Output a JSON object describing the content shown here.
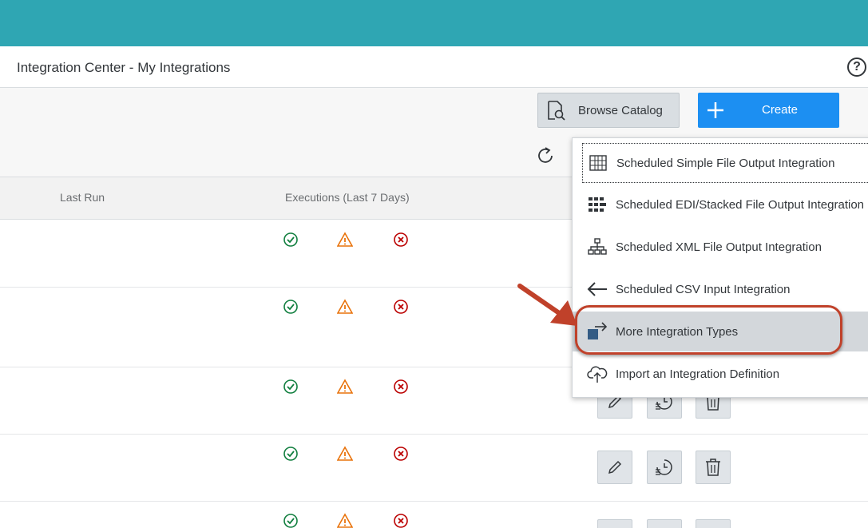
{
  "header": {
    "title": "Integration Center - My Integrations",
    "help_icon": "question-circle-icon",
    "help_glyph": "?"
  },
  "toolbar": {
    "browse_label": "Browse Catalog",
    "create_label": "Create",
    "refresh_icon": "refresh-icon"
  },
  "table": {
    "columns": [
      "Last Run",
      "Executions (Last 7 Days)"
    ]
  },
  "menu": {
    "items": [
      {
        "label": "Scheduled Simple File Output Integration",
        "icon": "grid-table-icon"
      },
      {
        "label": "Scheduled EDI/Stacked File Output Integration",
        "icon": "stacked-blocks-icon"
      },
      {
        "label": "Scheduled XML File Output Integration",
        "icon": "hierarchy-icon"
      },
      {
        "label": "Scheduled CSV Input Integration",
        "icon": "arrow-left-icon"
      },
      {
        "label": "More Integration Types",
        "icon": "share-out-icon"
      },
      {
        "label": "Import an Integration Definition",
        "icon": "cloud-upload-icon"
      }
    ]
  },
  "colors": {
    "top_bar": "#2fa6b3",
    "create_button": "#1c8ff2",
    "success": "#107e3e",
    "warning": "#e9730c",
    "error": "#bb0000",
    "annotation": "#c0412a"
  }
}
